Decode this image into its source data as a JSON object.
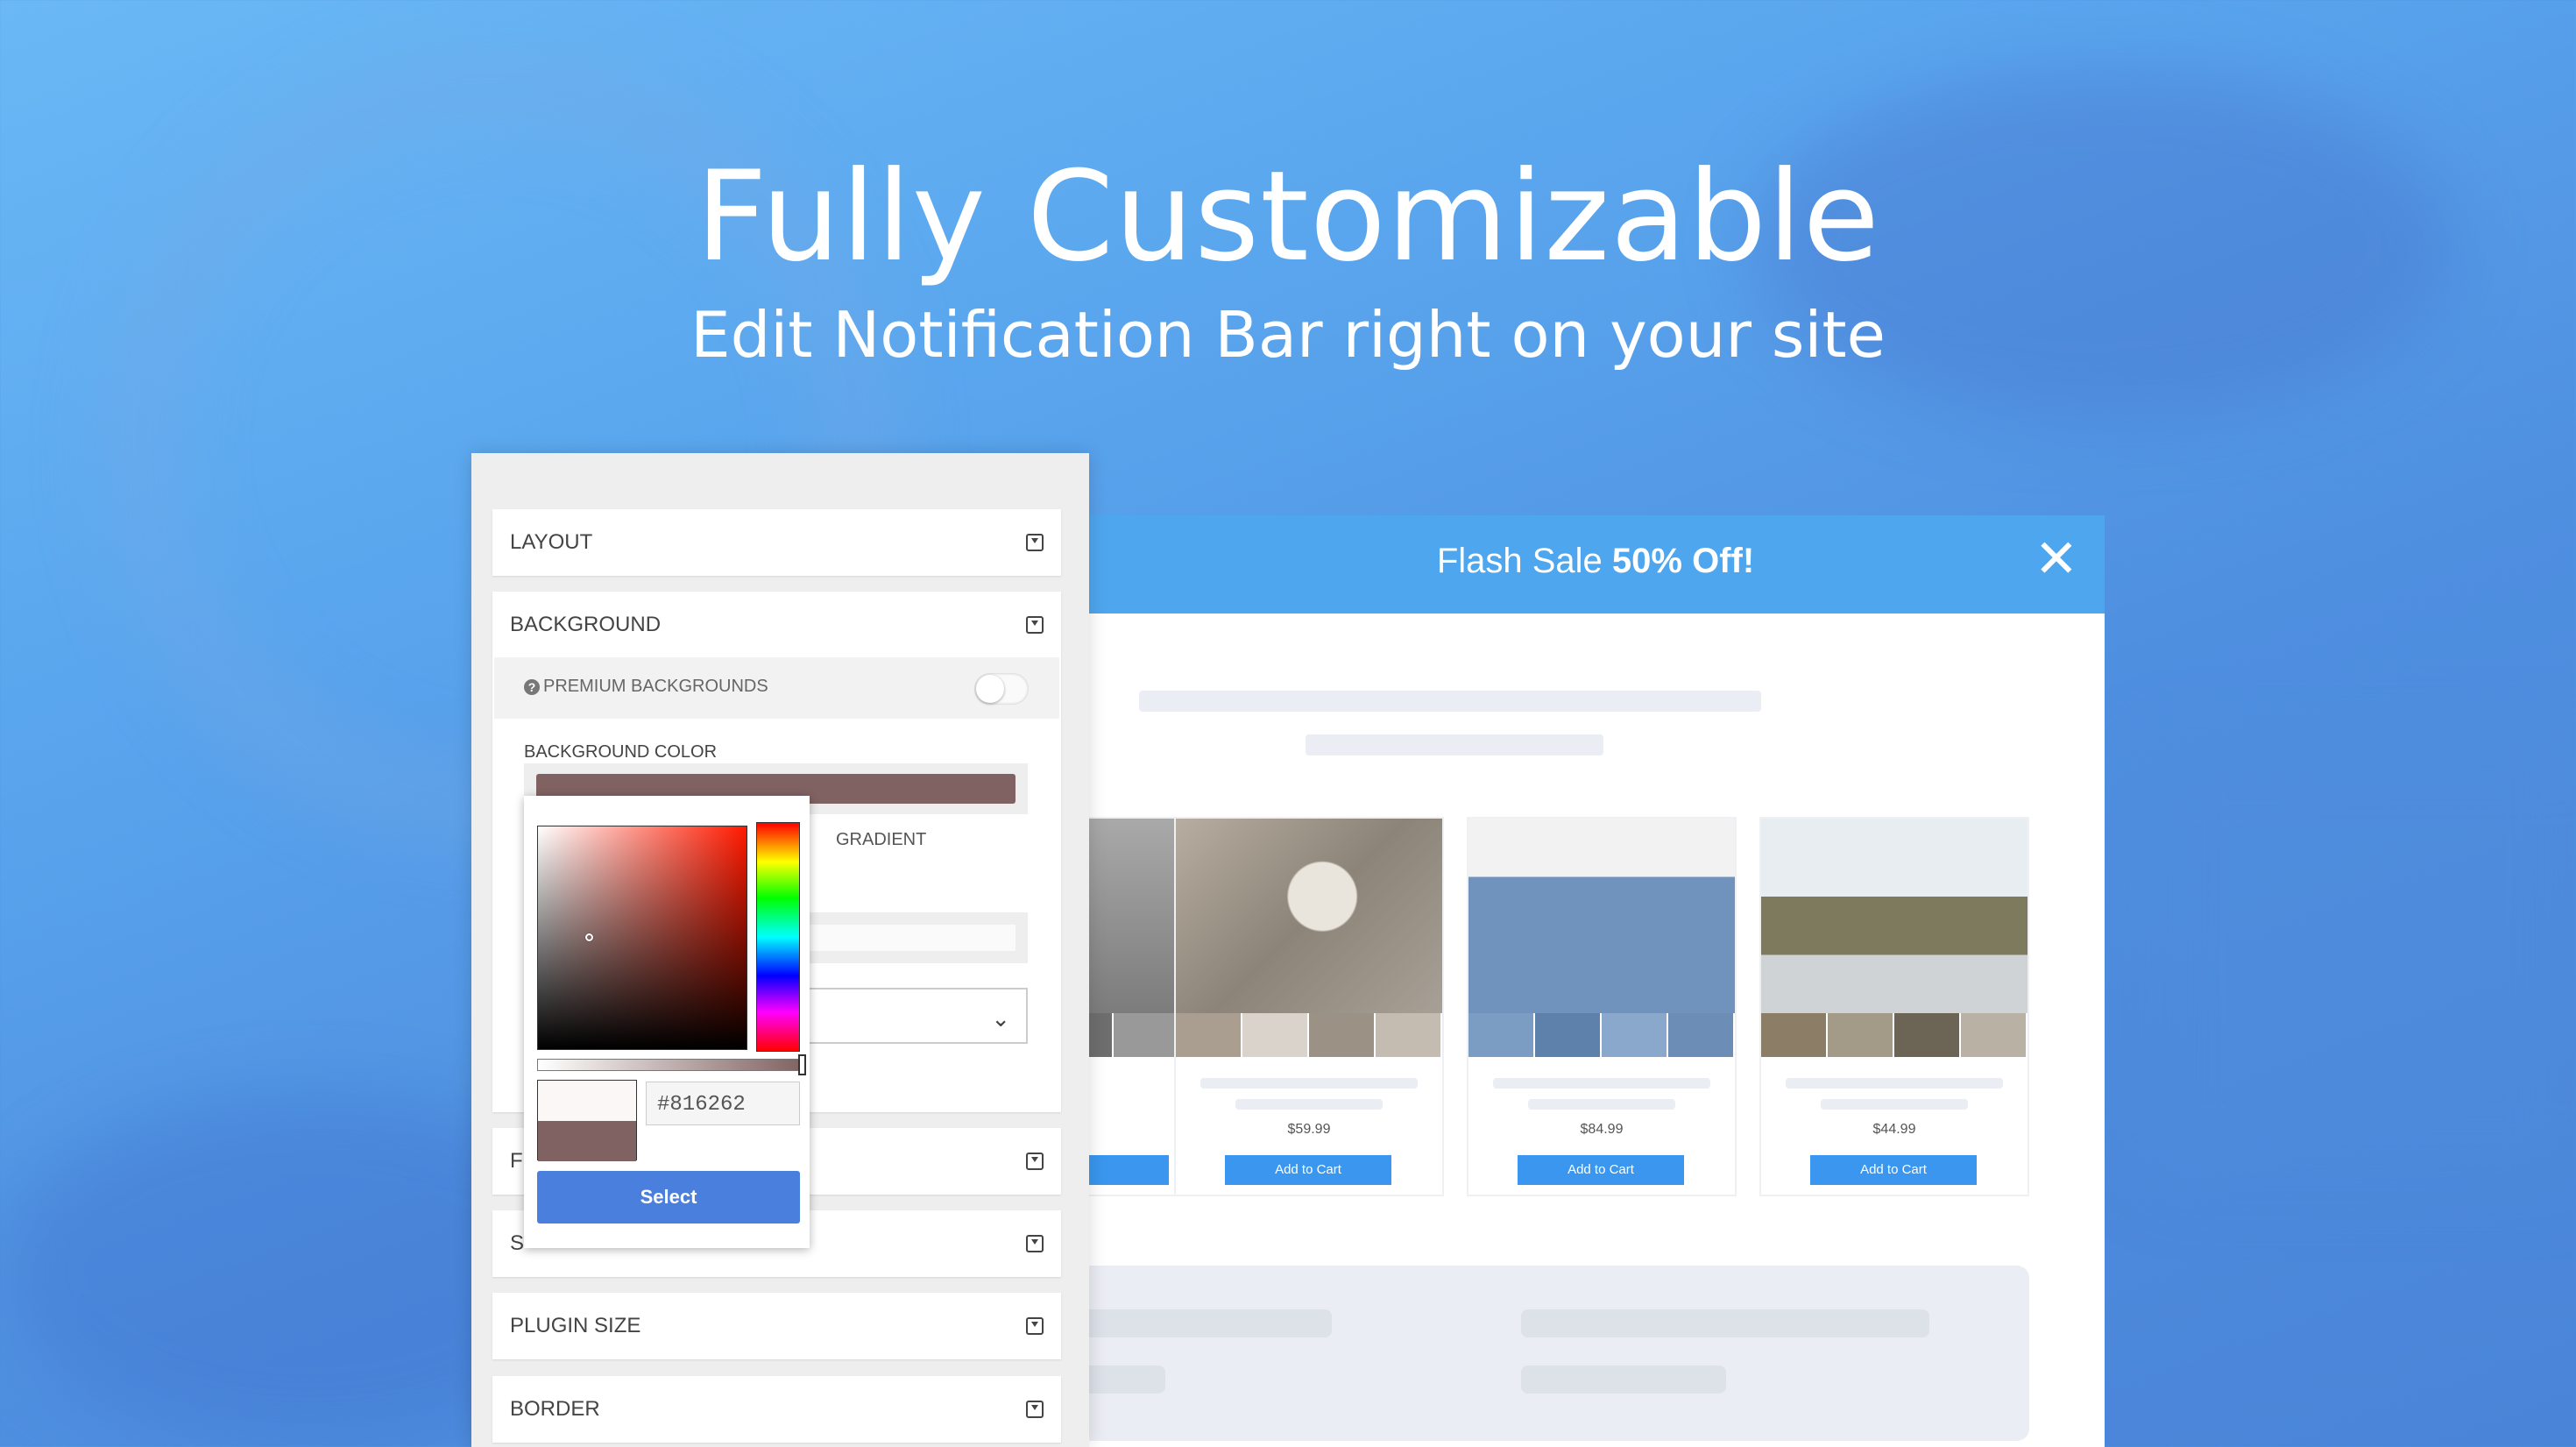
{
  "hero": {
    "title": "Fully Customizable",
    "subtitle": "Edit Notification Bar right on your site"
  },
  "notification_bar": {
    "text_prefix": "Flash Sale ",
    "text_emphasis": "50% Off!",
    "close_icon": "close-icon",
    "color": "#4ea6ee"
  },
  "products": [
    {
      "price": "",
      "button": ""
    },
    {
      "price": "$59.99",
      "button": "Add to Cart"
    },
    {
      "price": "$84.99",
      "button": "Add to Cart"
    },
    {
      "price": "$44.99",
      "button": "Add to Cart"
    }
  ],
  "editor": {
    "sections": [
      {
        "label": "LAYOUT"
      },
      {
        "label": "BACKGROUND"
      },
      {
        "label": "F"
      },
      {
        "label": "S"
      },
      {
        "label": "PLUGIN SIZE"
      },
      {
        "label": "BORDER"
      }
    ],
    "premium_backgrounds_label": "PREMIUM BACKGROUNDS",
    "background_color_label": "BACKGROUND COLOR",
    "gradient_label": "GRADIENT",
    "dropdown_icon": "chevron-down-icon"
  },
  "color_picker": {
    "hex_value": "#816262",
    "select_label": "Select",
    "current_color": "#816262"
  }
}
